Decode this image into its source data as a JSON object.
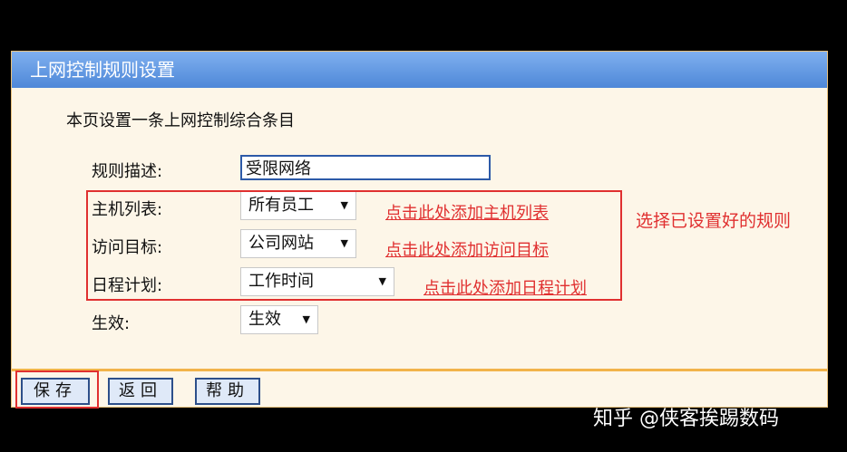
{
  "header": {
    "title": "上网控制规则设置"
  },
  "intro_text": "本页设置一条上网控制综合条目",
  "form": {
    "description": {
      "label": "规则描述:",
      "value": "受限网络"
    },
    "host_list": {
      "label": "主机列表:",
      "value": "所有员工"
    },
    "access_target": {
      "label": "访问目标:",
      "value": "公司网站"
    },
    "schedule": {
      "label": "日程计划:",
      "value": "工作时间"
    },
    "effective": {
      "label": "生效:",
      "value": "生效"
    }
  },
  "annotations": {
    "add_host_list": "点击此处添加主机列表",
    "add_access_target": "点击此处添加访问目标",
    "add_schedule": "点击此处添加日程计划",
    "select_rules": "选择已设置好的规则"
  },
  "buttons": {
    "save": "保存",
    "back": "返回",
    "help": "帮助"
  },
  "watermark": "知乎 @侠客挨踢数码",
  "icons": {
    "dropdown": "chevron-down-icon"
  },
  "colors": {
    "title_bar": "#4e88d8",
    "annotation_red": "#e03030",
    "panel_bg": "#fdf6e8",
    "divider": "#f2b34a"
  }
}
